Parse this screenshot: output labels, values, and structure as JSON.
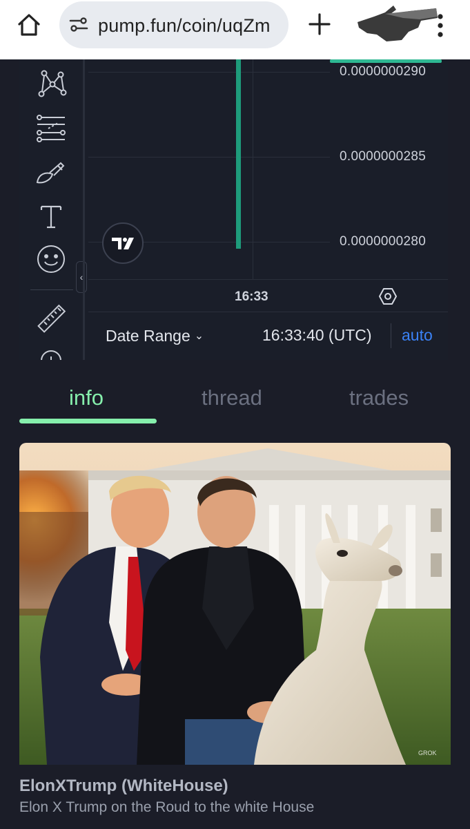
{
  "browser": {
    "url": "pump.fun/coin/uqZm"
  },
  "chart": {
    "price_labels": [
      "0.0000000290",
      "0.0000000285",
      "0.0000000280"
    ],
    "time_tick": "16:33",
    "date_range_label": "Date Range",
    "utc_time": "16:33:40 (UTC)",
    "auto_label": "auto",
    "candle_color": "#1e9c7b",
    "collapse_glyph": "‹"
  },
  "tabs": [
    {
      "label": "info",
      "active": true
    },
    {
      "label": "thread",
      "active": false
    },
    {
      "label": "trades",
      "active": false
    }
  ],
  "coin": {
    "name": "ElonXTrump (WhiteHouse)",
    "description": "Elon X Trump on the Roud to the white House",
    "image_watermark": "GROK"
  },
  "colors": {
    "accent_green": "#86efac",
    "link_blue": "#3b82f6",
    "background": "#1b1d28"
  }
}
